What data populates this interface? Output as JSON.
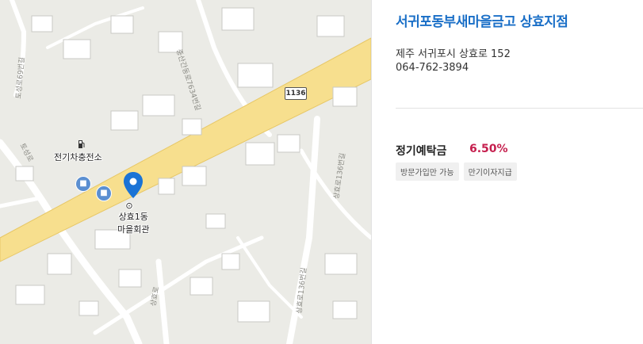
{
  "panel": {
    "bank_name": "서귀포동부새마을금고 상효지점",
    "address": "제주 서귀포시 상효로 152",
    "phone": "064-762-3894",
    "product": {
      "name": "정기예탁금",
      "rate": "6.50%"
    },
    "tags": [
      "방문가입만 가능",
      "만기이자지급"
    ]
  },
  "map": {
    "poi_charging": "전기차충전소",
    "poi_hall_line1": "상효1동",
    "poi_hall_line2": "마을회관",
    "route_number": "1136",
    "road_labels": [
      "토성로69번길",
      "중산간동로7634번길",
      "상효로136번길",
      "토성로",
      "상효로",
      "상효로136번길"
    ],
    "icons": {
      "charging": "fuel-pump-icon",
      "bus": "bus-stop-icon",
      "pin": "location-pin-icon"
    },
    "colors": {
      "highway": "#f7df8e",
      "pin": "#1a73d6",
      "bus": "#5b8fd1",
      "accent": "#1a6fc7",
      "rate": "#c51e4d"
    }
  }
}
